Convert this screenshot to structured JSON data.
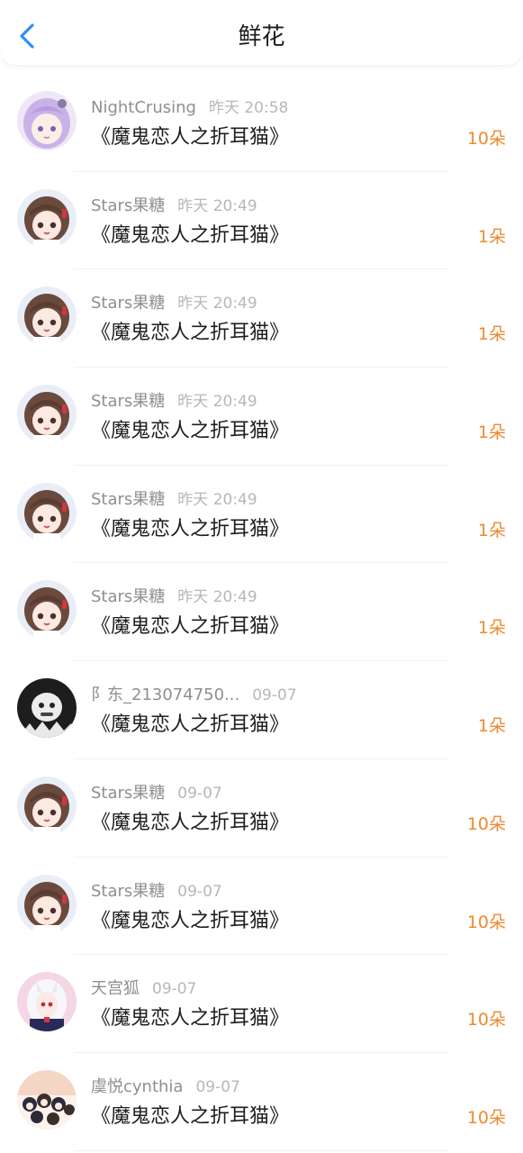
{
  "header": {
    "title": "鲜花",
    "back_icon": "chevron-left-icon"
  },
  "colors": {
    "accent": "#2f8ff7",
    "count": "#f0882e",
    "username": "#8f8f8f",
    "time": "#b7b7b7",
    "text": "#1e1e1e"
  },
  "items": [
    {
      "username": "NightCrusing",
      "time": "昨天 20:58",
      "book": "《魔鬼恋人之折耳猫》",
      "count": "10朵",
      "avatar": "purple-hair-girl"
    },
    {
      "username": "Stars果糖",
      "time": "昨天 20:49",
      "book": "《魔鬼恋人之折耳猫》",
      "count": "1朵",
      "avatar": "brown-hair-girl"
    },
    {
      "username": "Stars果糖",
      "time": "昨天 20:49",
      "book": "《魔鬼恋人之折耳猫》",
      "count": "1朵",
      "avatar": "brown-hair-girl"
    },
    {
      "username": "Stars果糖",
      "time": "昨天 20:49",
      "book": "《魔鬼恋人之折耳猫》",
      "count": "1朵",
      "avatar": "brown-hair-girl"
    },
    {
      "username": "Stars果糖",
      "time": "昨天 20:49",
      "book": "《魔鬼恋人之折耳猫》",
      "count": "1朵",
      "avatar": "brown-hair-girl"
    },
    {
      "username": "Stars果糖",
      "time": "昨天 20:49",
      "book": "《魔鬼恋人之折耳猫》",
      "count": "1朵",
      "avatar": "brown-hair-girl"
    },
    {
      "username": "阝东_213074750...",
      "time": "09-07",
      "book": "《魔鬼恋人之折耳猫》",
      "count": "1朵",
      "avatar": "dark-cartoon"
    },
    {
      "username": "Stars果糖",
      "time": "09-07",
      "book": "《魔鬼恋人之折耳猫》",
      "count": "10朵",
      "avatar": "brown-hair-girl"
    },
    {
      "username": "Stars果糖",
      "time": "09-07",
      "book": "《魔鬼恋人之折耳猫》",
      "count": "10朵",
      "avatar": "brown-hair-girl"
    },
    {
      "username": "天宫狐",
      "time": "09-07",
      "book": "《魔鬼恋人之折耳猫》",
      "count": "10朵",
      "avatar": "white-hair-girl"
    },
    {
      "username": "虞悦cynthia",
      "time": "09-07",
      "book": "《魔鬼恋人之折耳猫》",
      "count": "10朵",
      "avatar": "group-cartoon"
    }
  ]
}
